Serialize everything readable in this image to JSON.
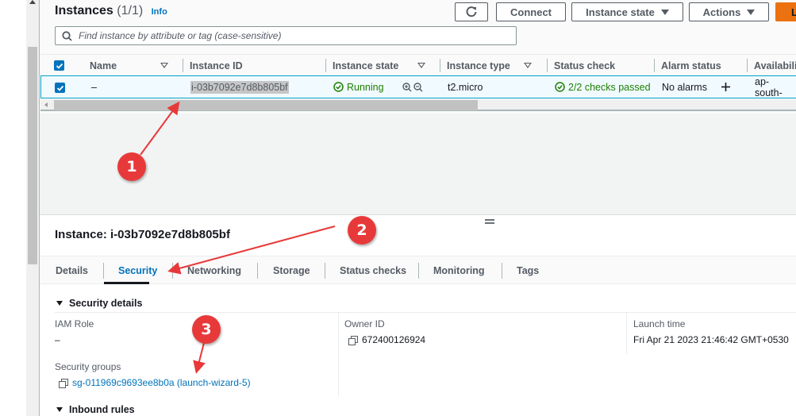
{
  "instances_panel": {
    "title": "Instances",
    "count": "(1/1)",
    "info_link": "Info",
    "buttons": {
      "refresh_icon": "refresh-icon",
      "connect": "Connect",
      "instance_state": "Instance state",
      "actions": "Actions",
      "launch_partial": "L"
    },
    "search": {
      "placeholder": "Find instance by attribute or tag (case-sensitive)",
      "value": ""
    },
    "table": {
      "columns": [
        "Name",
        "Instance ID",
        "Instance state",
        "Instance type",
        "Status check",
        "Alarm status",
        "Availabili"
      ],
      "rows": [
        {
          "selected": true,
          "name": "–",
          "instance_id": "i-03b7092e7d8b805bf",
          "instance_state": "Running",
          "instance_type": "t2.micro",
          "status_check": "2/2 checks passed",
          "alarm_status": "No alarms",
          "availability_zone": "ap-south-"
        }
      ]
    }
  },
  "detail_panel": {
    "title": "Instance: i-03b7092e7d8b805bf",
    "tabs": [
      "Details",
      "Security",
      "Networking",
      "Storage",
      "Status checks",
      "Monitoring",
      "Tags"
    ],
    "active_tab": "Security",
    "security_details": {
      "heading": "Security details",
      "iam_role_label": "IAM Role",
      "iam_role_value": "–",
      "owner_id_label": "Owner ID",
      "owner_id_value": "672400126924",
      "launch_time_label": "Launch time",
      "launch_time_value": "Fri Apr 21 2023 21:46:42 GMT+0530",
      "security_groups_label": "Security groups",
      "security_groups_value": "sg-011969c9693ee8b0a (launch-wizard-5)"
    },
    "inbound_rules_heading": "Inbound rules"
  },
  "annotations": {
    "badge_1": "1",
    "badge_2": "2",
    "badge_3": "3",
    "color": "#e8393a"
  }
}
